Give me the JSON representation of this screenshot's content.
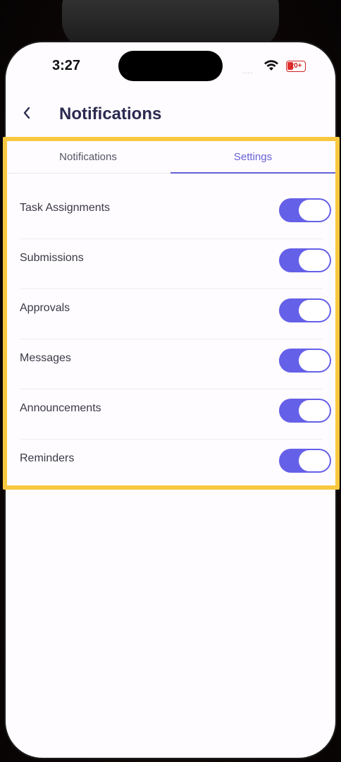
{
  "status_bar": {
    "time": "3:27",
    "signal": "....",
    "battery": "20+"
  },
  "header": {
    "back_icon": "chevron-left-icon",
    "title": "Notifications"
  },
  "tabs": [
    {
      "label": "Notifications",
      "active": false
    },
    {
      "label": "Settings",
      "active": true
    }
  ],
  "settings": [
    {
      "label": "Task Assignments",
      "enabled": true
    },
    {
      "label": "Submissions",
      "enabled": true
    },
    {
      "label": "Approvals",
      "enabled": true
    },
    {
      "label": "Messages",
      "enabled": true
    },
    {
      "label": "Announcements",
      "enabled": true
    },
    {
      "label": "Reminders",
      "enabled": true
    }
  ],
  "colors": {
    "accent": "#6660d6",
    "toggle_on": "#6560e8",
    "highlight": "#f8c840",
    "title": "#2b2a50"
  }
}
